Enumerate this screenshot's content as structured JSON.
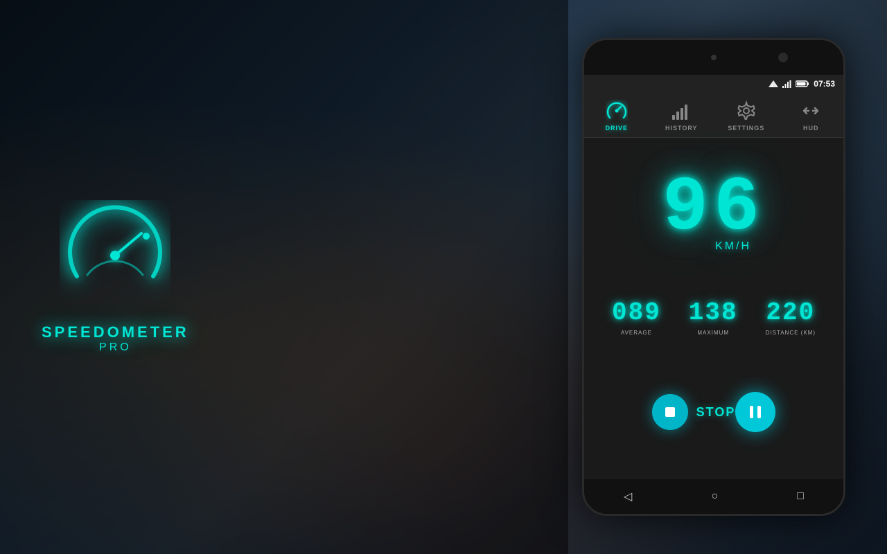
{
  "app": {
    "name": "SPEEDOMETER",
    "subtitle": "PRO"
  },
  "phone": {
    "status_bar": {
      "time": "07:53",
      "signal_icon": "▼▲",
      "wifi_bars": "||||",
      "battery": "□"
    },
    "nav_tabs": [
      {
        "id": "drive",
        "label": "DRIVE",
        "active": true,
        "icon": "speedometer-icon"
      },
      {
        "id": "history",
        "label": "HISTORY",
        "active": false,
        "icon": "bar-chart-icon"
      },
      {
        "id": "settings",
        "label": "SETTINGS",
        "active": false,
        "icon": "gear-icon"
      },
      {
        "id": "hud",
        "label": "HUD",
        "active": false,
        "icon": "hud-icon"
      }
    ],
    "speed": {
      "value": "96",
      "unit": "KM/H"
    },
    "stats": [
      {
        "id": "average",
        "value": "089",
        "label": "AVERAGE"
      },
      {
        "id": "maximum",
        "value": "138",
        "label": "MAXIMUM"
      },
      {
        "id": "distance",
        "value": "220",
        "label": "DISTANCE (KM)"
      }
    ],
    "controls": {
      "stop_label": "STOP",
      "stop_icon": "stop-icon",
      "pause_icon": "pause-icon"
    },
    "bottom_nav": {
      "back": "◁",
      "home": "○",
      "recents": "□"
    }
  }
}
